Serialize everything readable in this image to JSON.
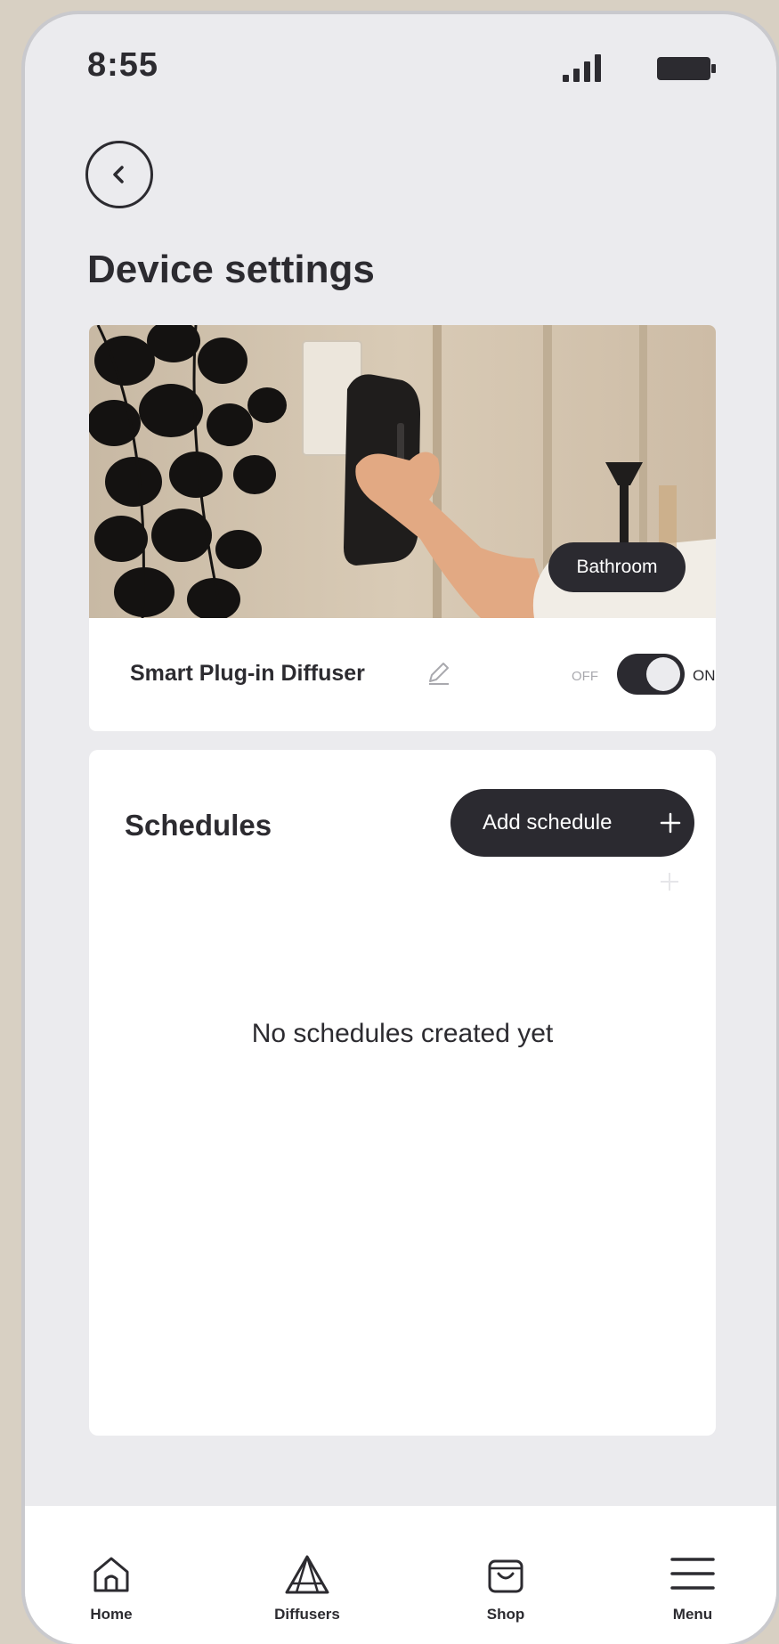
{
  "status_bar": {
    "time": "8:55"
  },
  "header": {
    "title": "Device settings"
  },
  "device": {
    "name": "Smart Plug-in Diffuser",
    "room": "Bathroom",
    "toggle": {
      "off_label": "OFF",
      "on_label": "ON",
      "state": "on"
    }
  },
  "schedules": {
    "title": "Schedules",
    "add_button_label": "Add schedule",
    "empty_message": "No schedules created yet"
  },
  "tab_bar": {
    "items": [
      {
        "label": "Home",
        "icon": "home-icon"
      },
      {
        "label": "Diffusers",
        "icon": "diffuser-icon"
      },
      {
        "label": "Shop",
        "icon": "shopping-bag-icon"
      },
      {
        "label": "Menu",
        "icon": "hamburger-menu-icon"
      }
    ]
  },
  "colors": {
    "page_background": "#d8d0c3",
    "screen_background": "#ebebee",
    "card": "#ffffff",
    "dark": "#2b2a30",
    "muted": "#a9a9ae"
  }
}
